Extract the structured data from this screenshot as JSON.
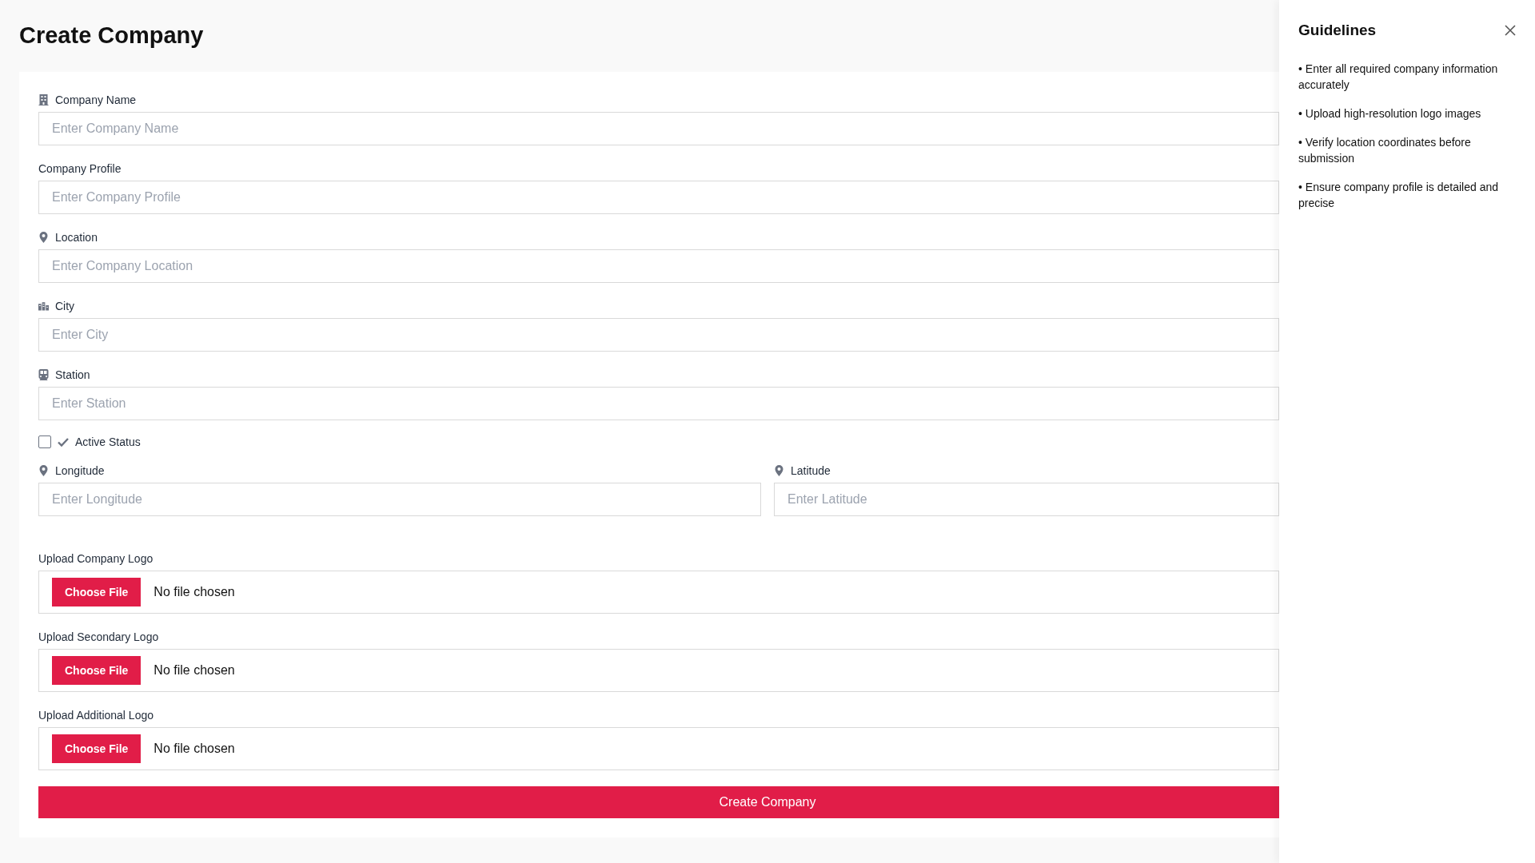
{
  "title": "Create Company",
  "text_fields": [
    {
      "label": "Company Name",
      "placeholder": "Enter Company Name"
    },
    {
      "label": "Company Profile",
      "placeholder": "Enter Company Profile"
    },
    {
      "label": "Location",
      "placeholder": "Enter Company Location"
    },
    {
      "label": "City",
      "placeholder": "Enter City"
    },
    {
      "label": "Station",
      "placeholder": "Enter Station"
    }
  ],
  "active_status": {
    "label": "Active Status",
    "checked": false
  },
  "coordinates": [
    {
      "label": "Longitude",
      "placeholder": "Enter Longitude"
    },
    {
      "label": "Latitude",
      "placeholder": "Enter Latitude"
    }
  ],
  "uploads": [
    {
      "label": "Upload Company Logo",
      "button": "Choose File",
      "status": "No file chosen"
    },
    {
      "label": "Upload Secondary Logo",
      "button": "Choose File",
      "status": "No file chosen"
    },
    {
      "label": "Upload Additional Logo",
      "button": "Choose File",
      "status": "No file chosen"
    }
  ],
  "submit": "Create Company",
  "guidelines": {
    "title": "Guidelines",
    "items": [
      "• Enter all required company information accurately",
      "• Upload high-resolution logo images",
      "• Verify location coordinates before submission",
      "• Ensure company profile is detailed and precise"
    ]
  }
}
